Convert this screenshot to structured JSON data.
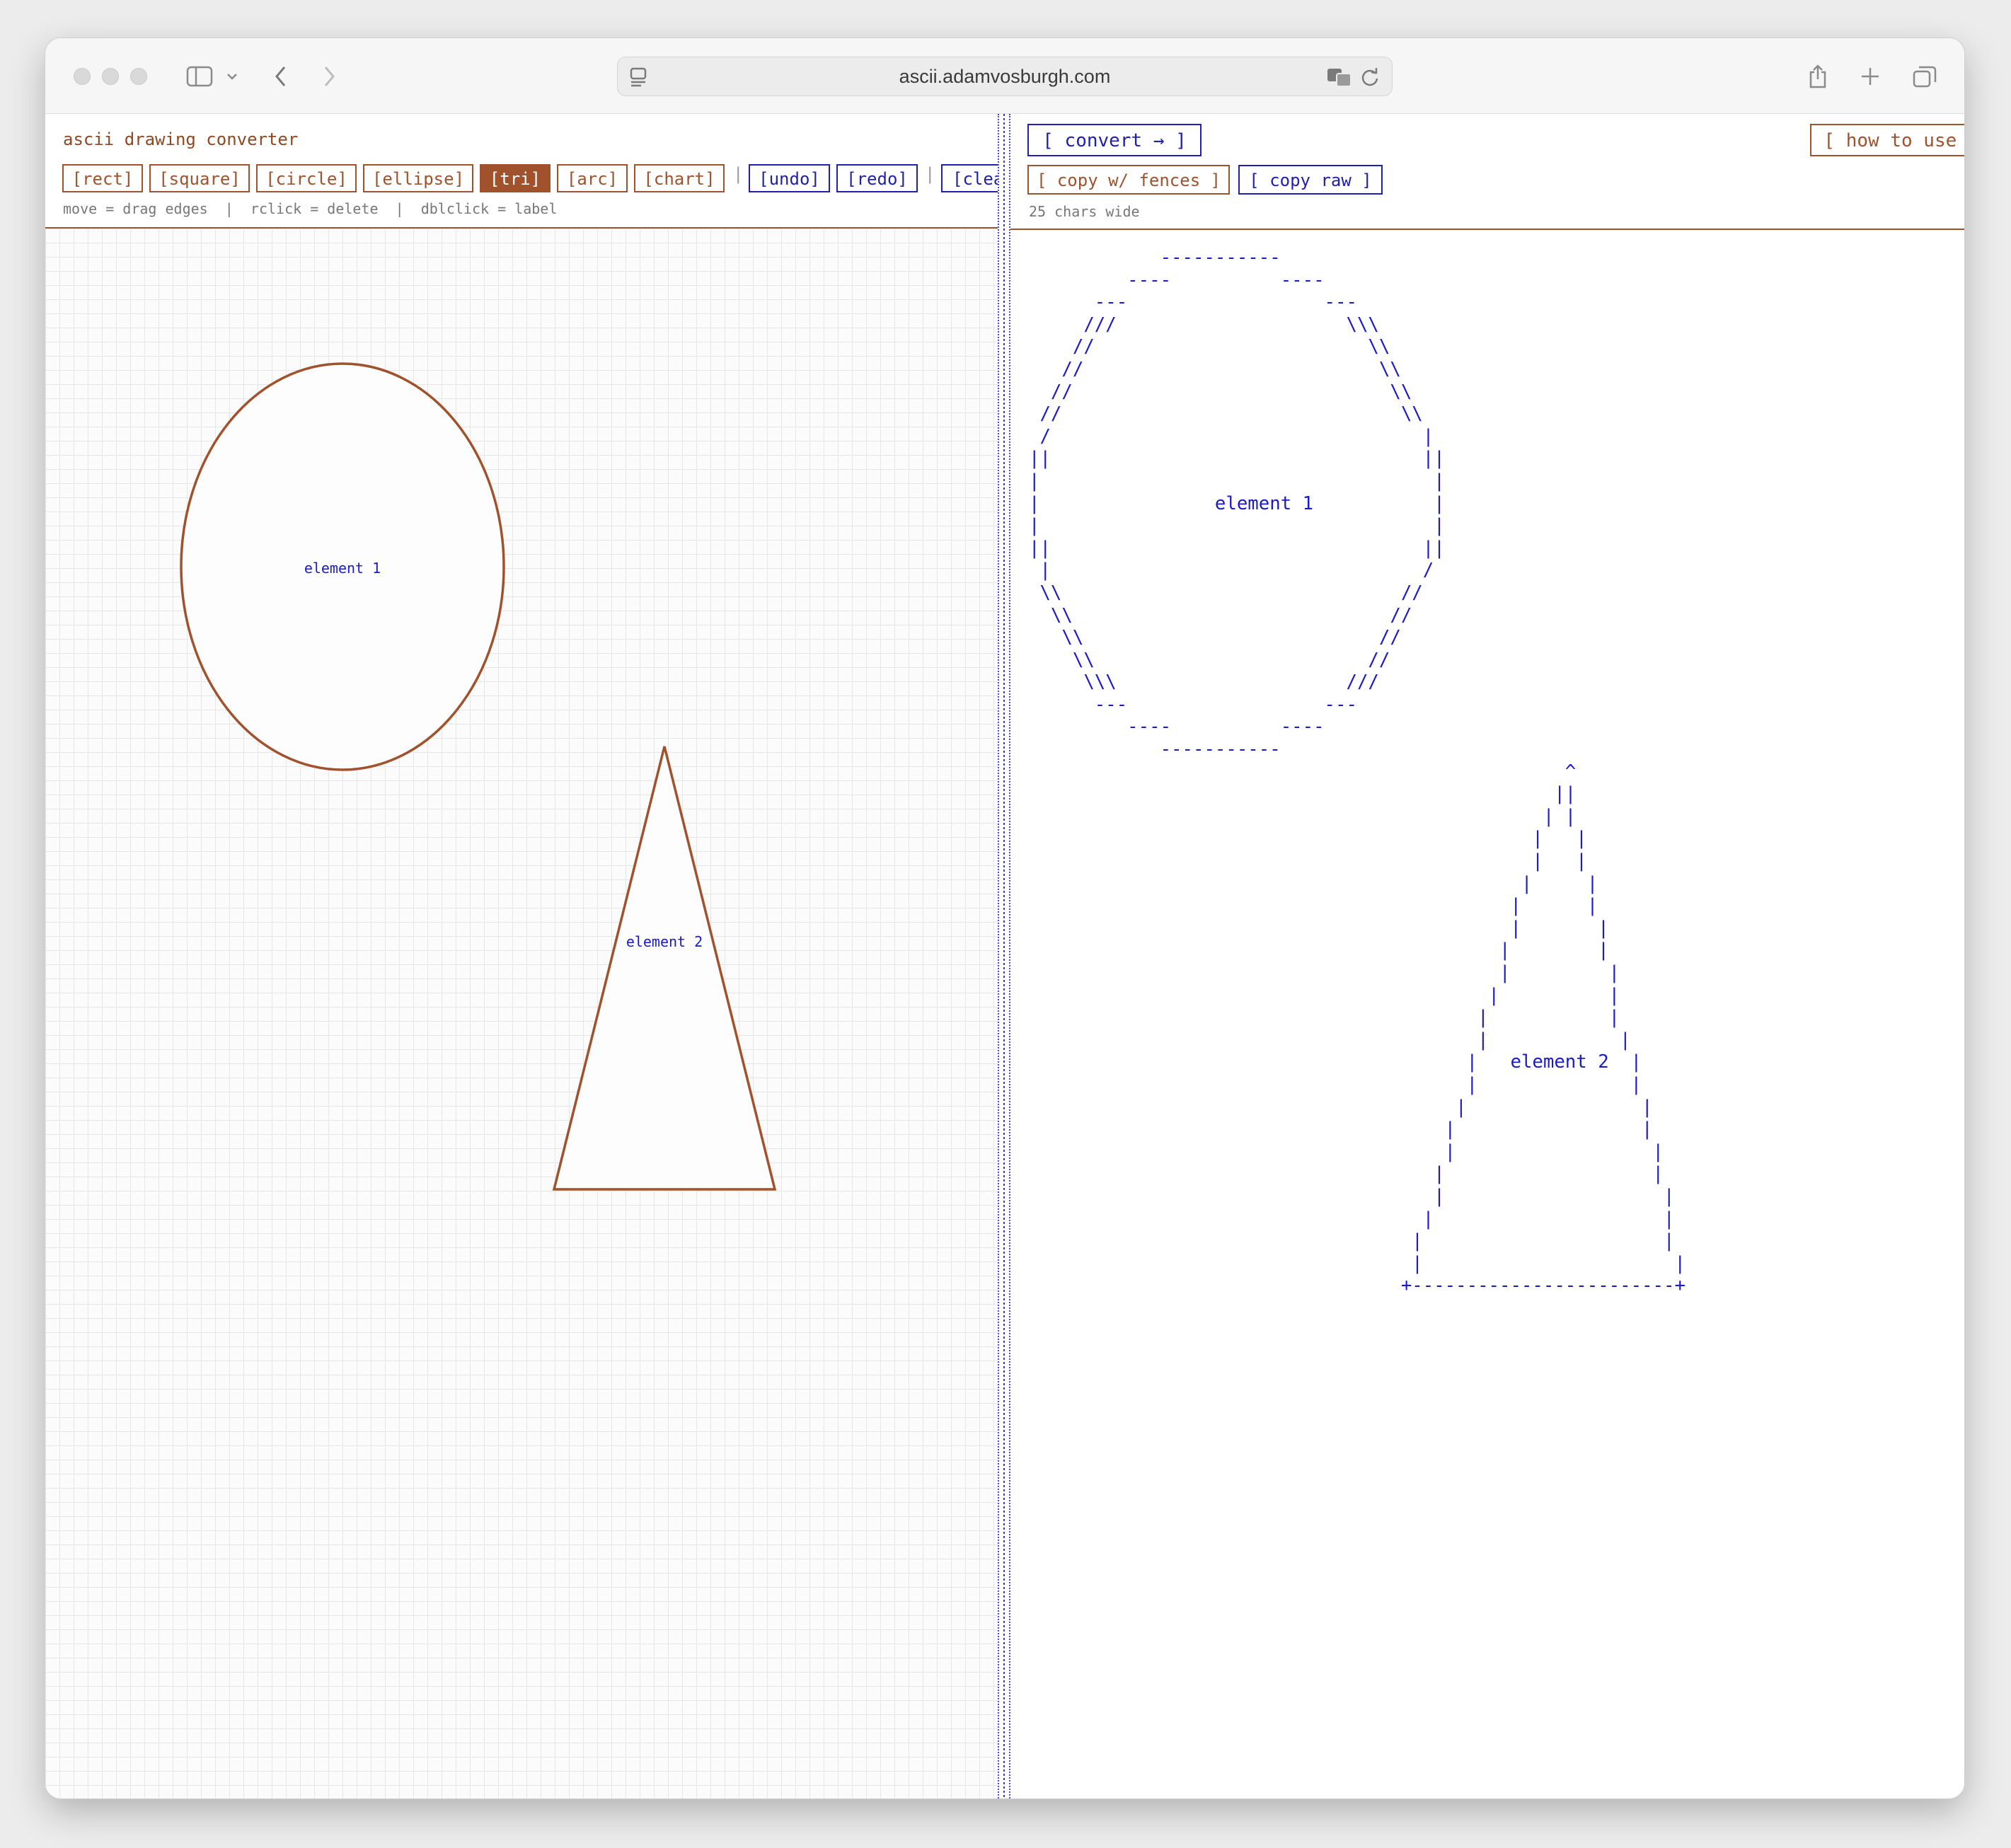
{
  "browser": {
    "url": "ascii.adamvosburgh.com"
  },
  "app": {
    "title": "ascii drawing converter",
    "shape_tools": [
      "[rect]",
      "[square]",
      "[circle]",
      "[ellipse]",
      "[tri]",
      "[arc]",
      "[chart]"
    ],
    "active_tool": "[tri]",
    "history_tools": [
      "[undo]",
      "[redo]"
    ],
    "clear_label": "[clear]",
    "hint": "move = drag edges  |  rclick = delete  |  dblclick = label",
    "separator": "|"
  },
  "canvas": {
    "elements": [
      {
        "kind": "ellipse",
        "label": "element 1"
      },
      {
        "kind": "triangle",
        "label": "element 2"
      }
    ],
    "stroke_color": "#a0522d",
    "label_color": "#1a1ac8"
  },
  "output": {
    "convert_label": "[ convert → ]",
    "how_to_label": "[ how to use ]",
    "copy_fences_label": "[ copy w/ fences ]",
    "copy_raw_label": "[ copy raw ]",
    "width_info": "25 chars wide",
    "ascii": "            -----------\n         ----          ----\n      ---                  ---\n     ///                     \\\\\\\n    //                         \\\\\n   //                           \\\\\n  //                             \\\\\n //                               \\\\\n /                                  |\n||                                  ||\n|                                    |\n|                element 1           |\n|                                    |\n||                                  ||\n |                                  /\n \\\\                               //\n  \\\\                             //\n   \\\\                           //\n    \\\\                         //\n     \\\\\\                     ///\n      ---                  ---\n         ----          ----\n            -----------\n                                                 ^\n                                                ||\n                                               | |\n                                              |   |\n                                              |   |\n                                             |     |\n                                            |      |\n                                            |       |\n                                           |        |\n                                           |         |\n                                          |          |\n                                         |           |\n                                         |            |\n                                        |   element 2  |\n                                        |              |\n                                       |                |\n                                      |                 |\n                                      |                  |\n                                     |                   |\n                                     |                    |\n                                    |                     |\n                                   |                      |\n                                   |                       |\n                                  +------------------------+"
  }
}
